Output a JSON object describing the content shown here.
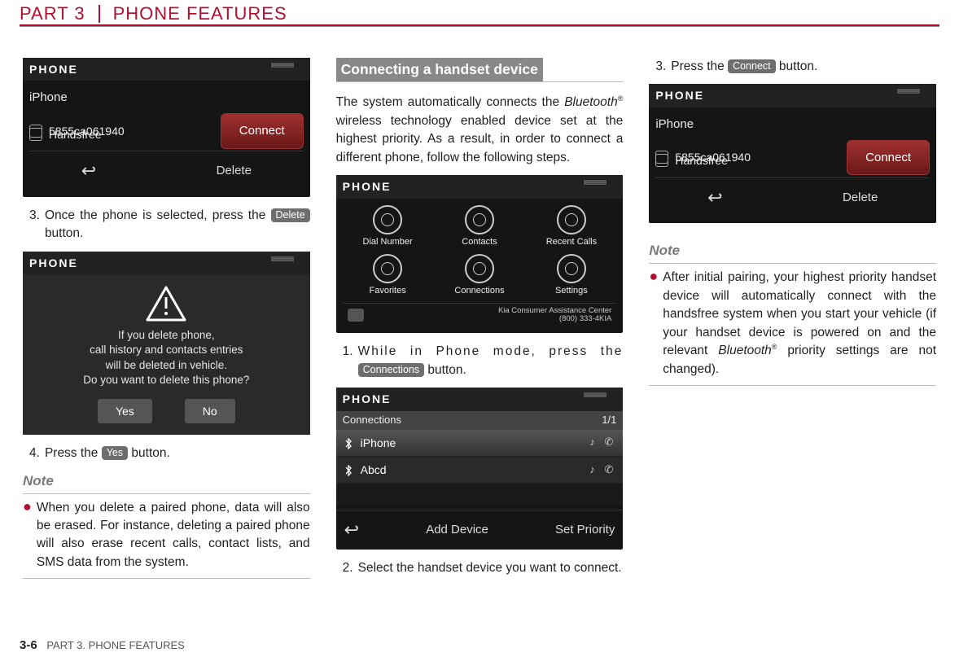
{
  "header": {
    "part": "PART 3",
    "title": "PHONE FEATURES"
  },
  "screens": {
    "phone_label": "PHONE",
    "device": "iPhone",
    "mac": "5855ca061940",
    "handsfree": "Handsfree",
    "connect": "Connect",
    "delete": "Delete",
    "dialog": {
      "l1": "If you delete phone,",
      "l2": "call history and contacts entries",
      "l3": "will be deleted in vehicle.",
      "l4": "Do you want to delete this phone?",
      "yes": "Yes",
      "no": "No"
    },
    "menu": {
      "items": [
        "Dial Number",
        "Contacts",
        "Recent Calls",
        "Favorites",
        "Connections",
        "Settings"
      ],
      "kia1": "Kia Consumer Assistance Center",
      "kia2": "(800) 333-4KIA"
    },
    "conn": {
      "title": "Connections",
      "count": "1/1",
      "r1": "iPhone",
      "r2": "Abcd",
      "add": "Add Device",
      "setp": "Set Priority"
    }
  },
  "col1": {
    "step3a": "Once the phone is selected, press the ",
    "step3b": " button.",
    "step4a": "Press the ",
    "step4b": " button.",
    "pill_delete": "Delete",
    "pill_yes": "Yes",
    "note_h": "Note",
    "note_body": "When you delete a paired phone, data will also be erased. For instance, deleting a paired phone will also erase recent calls, contact lists, and SMS data from the system."
  },
  "col2": {
    "section": "Connecting a handset device",
    "intro_a": "The system automatically connects the ",
    "intro_b": "Bluetooth",
    "intro_c": " wireless technology enabled device set at the highest priority. As a result, in order to connect a different phone, follow the following steps.",
    "step1a": "While in Phone mode, press the ",
    "step1b": " button.",
    "pill_conn": "Connections",
    "step2": "Select the handset device you want to connect."
  },
  "col3": {
    "step3a": "Press the ",
    "step3b": " button.",
    "pill_connect": "Connect",
    "note_h": "Note",
    "note_a": "After initial pairing, your highest priority handset device will automatically connect with the handsfree system when you start your vehicle (if your handset device is powered on and the relevant ",
    "note_b": "Bluetooth",
    "note_c": " priority settings are not changed)."
  },
  "footer": {
    "page": "3-6",
    "text": "PART 3. PHONE FEATURES"
  }
}
